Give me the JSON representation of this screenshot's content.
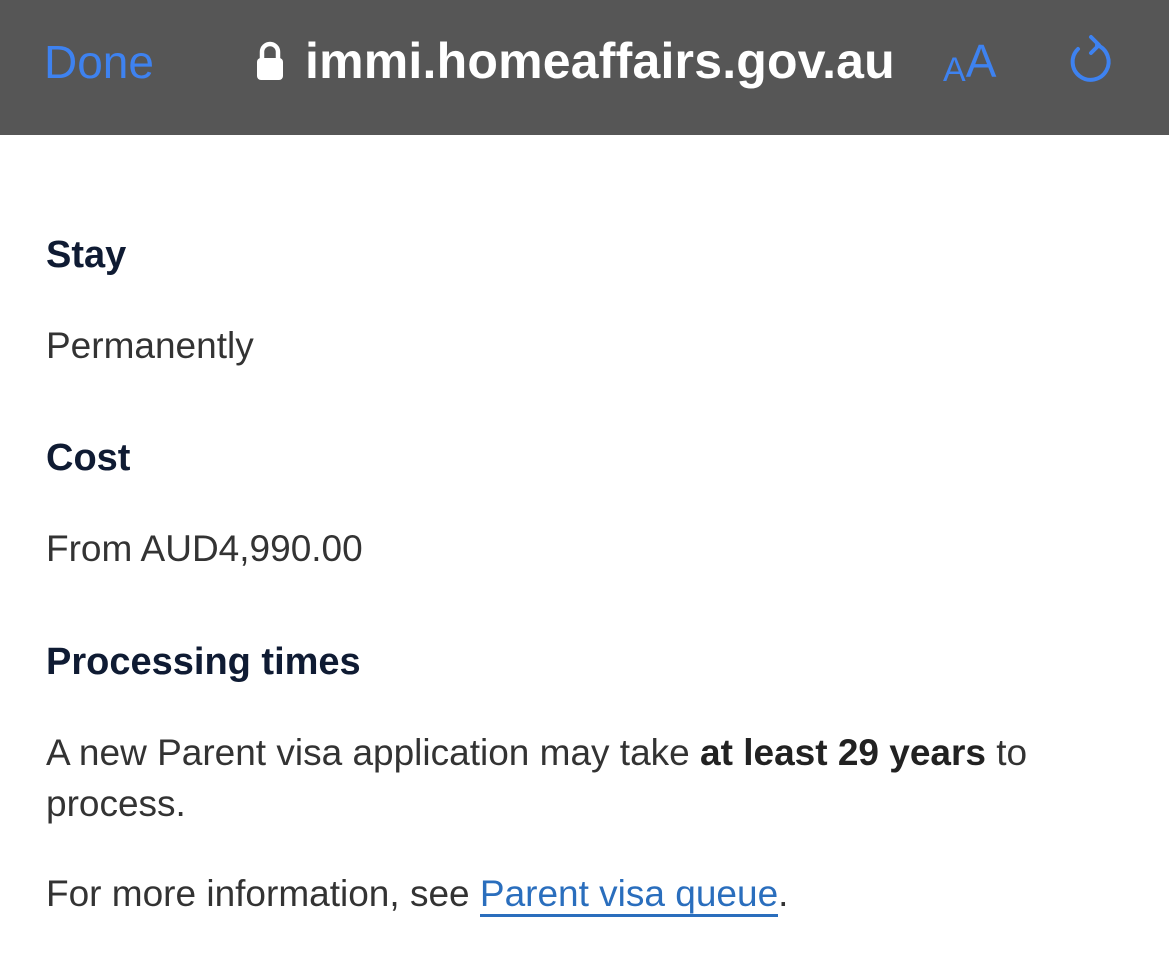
{
  "toolbar": {
    "done_label": "Done",
    "url": "immi.homeaffairs.gov.au",
    "text_size_small": "A",
    "text_size_big": "A"
  },
  "colors": {
    "toolbar_bg": "#565656",
    "accent": "#3e82f0",
    "heading": "#0f1b33",
    "link": "#2a6ebd"
  },
  "icons": {
    "lock": "lock-icon",
    "reload": "reload-icon"
  },
  "sections": {
    "stay": {
      "heading": "Stay",
      "value": "Permanently"
    },
    "cost": {
      "heading": "Cost",
      "value": "From AUD4,990.00"
    },
    "processing": {
      "heading": "Processing times",
      "text_before": "A new Parent visa application may take ",
      "text_bold": "at least 29 years",
      "text_after": " to process.",
      "more_info_prefix": "For more information, see ",
      "more_info_link": "Parent visa queue",
      "more_info_suffix": "."
    }
  }
}
